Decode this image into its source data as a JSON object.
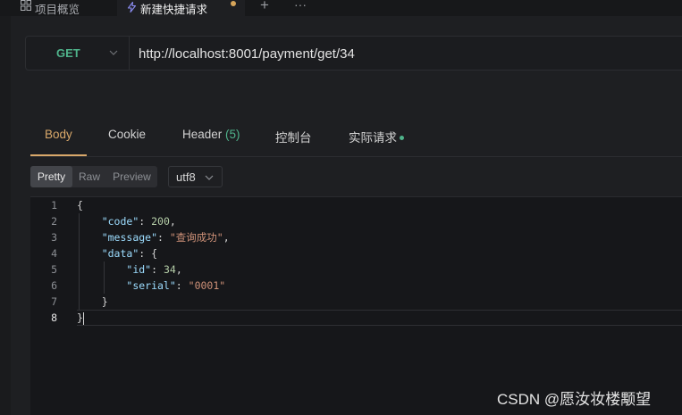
{
  "tabs": {
    "overview_label": "项目概览",
    "active_label": "新建快捷请求",
    "plus": "+",
    "more": "···"
  },
  "request": {
    "method": "GET",
    "url": "http://localhost:8001/payment/get/34"
  },
  "response_tabs": {
    "body": "Body",
    "cookie": "Cookie",
    "header": "Header",
    "header_count": "(5)",
    "console": "控制台",
    "real_request": "实际请求"
  },
  "format": {
    "pretty": "Pretty",
    "raw": "Raw",
    "preview": "Preview",
    "encoding": "utf8"
  },
  "code": {
    "line_numbers": [
      "1",
      "2",
      "3",
      "4",
      "5",
      "6",
      "7",
      "8"
    ],
    "open_brace": "{",
    "code_key": "\"code\"",
    "code_val": "200",
    "message_key": "\"message\"",
    "message_val": "\"查询成功\"",
    "data_key": "\"data\"",
    "data_open": "{",
    "id_key": "\"id\"",
    "id_val": "34",
    "serial_key": "\"serial\"",
    "serial_val": "\"0001\"",
    "inner_close": "}",
    "close_brace": "}"
  },
  "watermark": "CSDN @愿汝妆楼颙望",
  "colors": {
    "accent_orange": "#d9a86a",
    "method_green": "#4fb38b",
    "unsaved_dot": "#d7a55a"
  }
}
